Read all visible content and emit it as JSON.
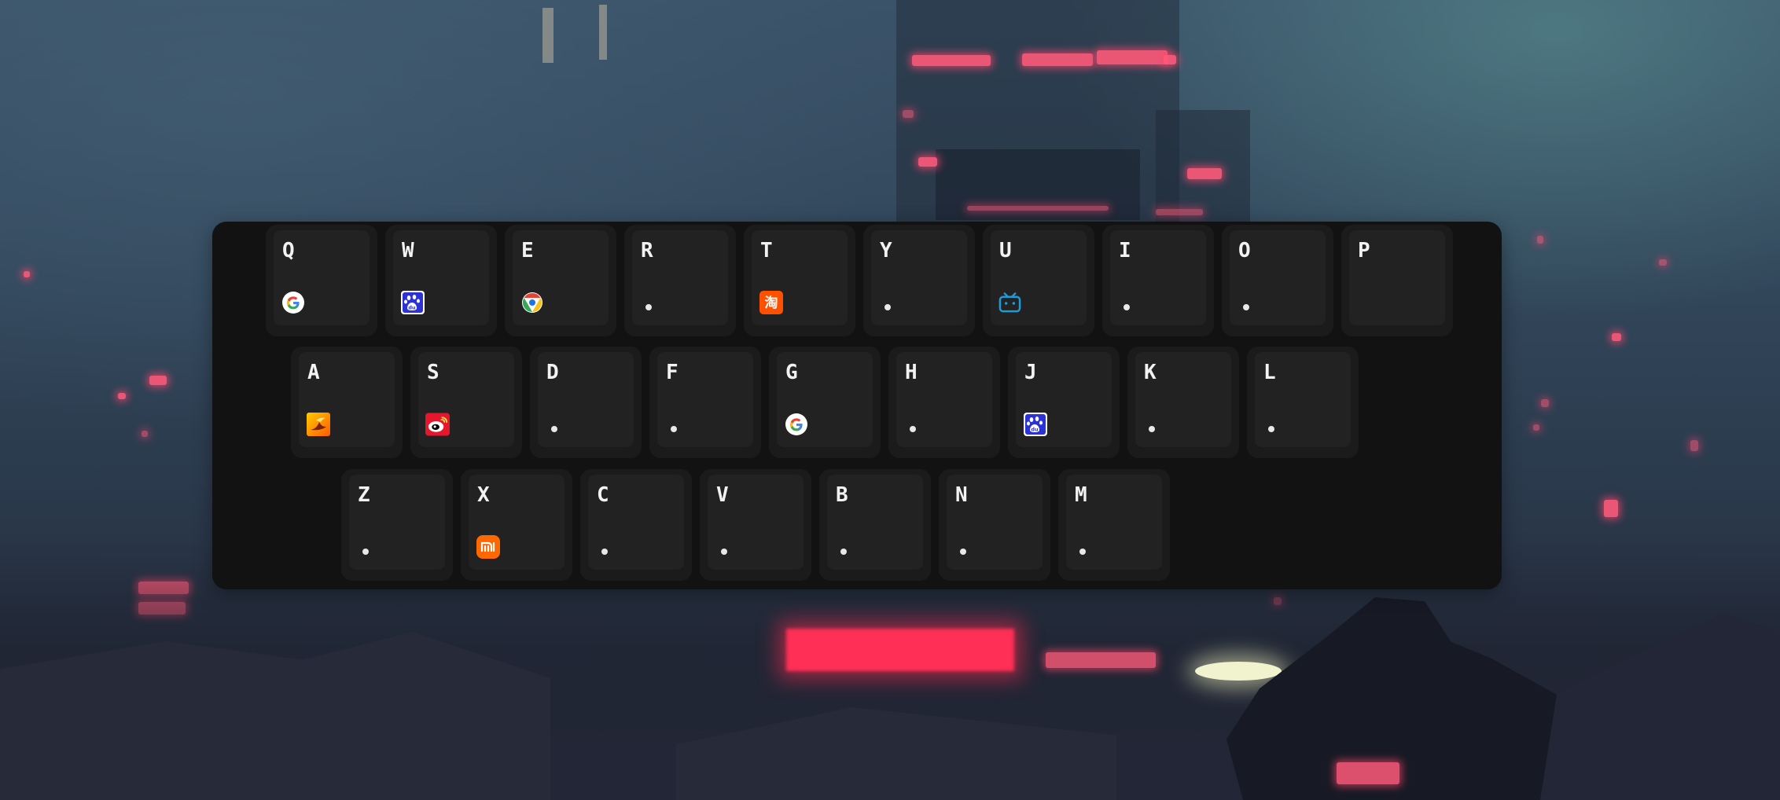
{
  "keyboard": {
    "rows": [
      [
        {
          "letter": "Q",
          "icon": "google-icon"
        },
        {
          "letter": "W",
          "icon": "baidu-icon"
        },
        {
          "letter": "E",
          "icon": "chrome-like-icon"
        },
        {
          "letter": "R",
          "icon": "dot"
        },
        {
          "letter": "T",
          "icon": "taobao-icon"
        },
        {
          "letter": "Y",
          "icon": "dot"
        },
        {
          "letter": "U",
          "icon": "bilibili-icon"
        },
        {
          "letter": "I",
          "icon": "dot"
        },
        {
          "letter": "O",
          "icon": "dot"
        },
        {
          "letter": "P",
          "icon": "none"
        }
      ],
      [
        {
          "letter": "A",
          "icon": "orange-app-icon"
        },
        {
          "letter": "S",
          "icon": "weibo-icon"
        },
        {
          "letter": "D",
          "icon": "dot"
        },
        {
          "letter": "F",
          "icon": "dot"
        },
        {
          "letter": "G",
          "icon": "google-icon"
        },
        {
          "letter": "H",
          "icon": "dot"
        },
        {
          "letter": "J",
          "icon": "baidu-icon"
        },
        {
          "letter": "K",
          "icon": "dot"
        },
        {
          "letter": "L",
          "icon": "dot"
        }
      ],
      [
        {
          "letter": "Z",
          "icon": "dot"
        },
        {
          "letter": "X",
          "icon": "xiaomi-icon"
        },
        {
          "letter": "C",
          "icon": "dot"
        },
        {
          "letter": "V",
          "icon": "dot"
        },
        {
          "letter": "B",
          "icon": "dot"
        },
        {
          "letter": "N",
          "icon": "dot"
        },
        {
          "letter": "M",
          "icon": "dot"
        }
      ]
    ]
  },
  "colors": {
    "panel": "#121212",
    "key": "#1b1b1b",
    "key_inner": "#222222",
    "letter": "#f2f2f2",
    "accent_neon": "#ff3b5c"
  }
}
